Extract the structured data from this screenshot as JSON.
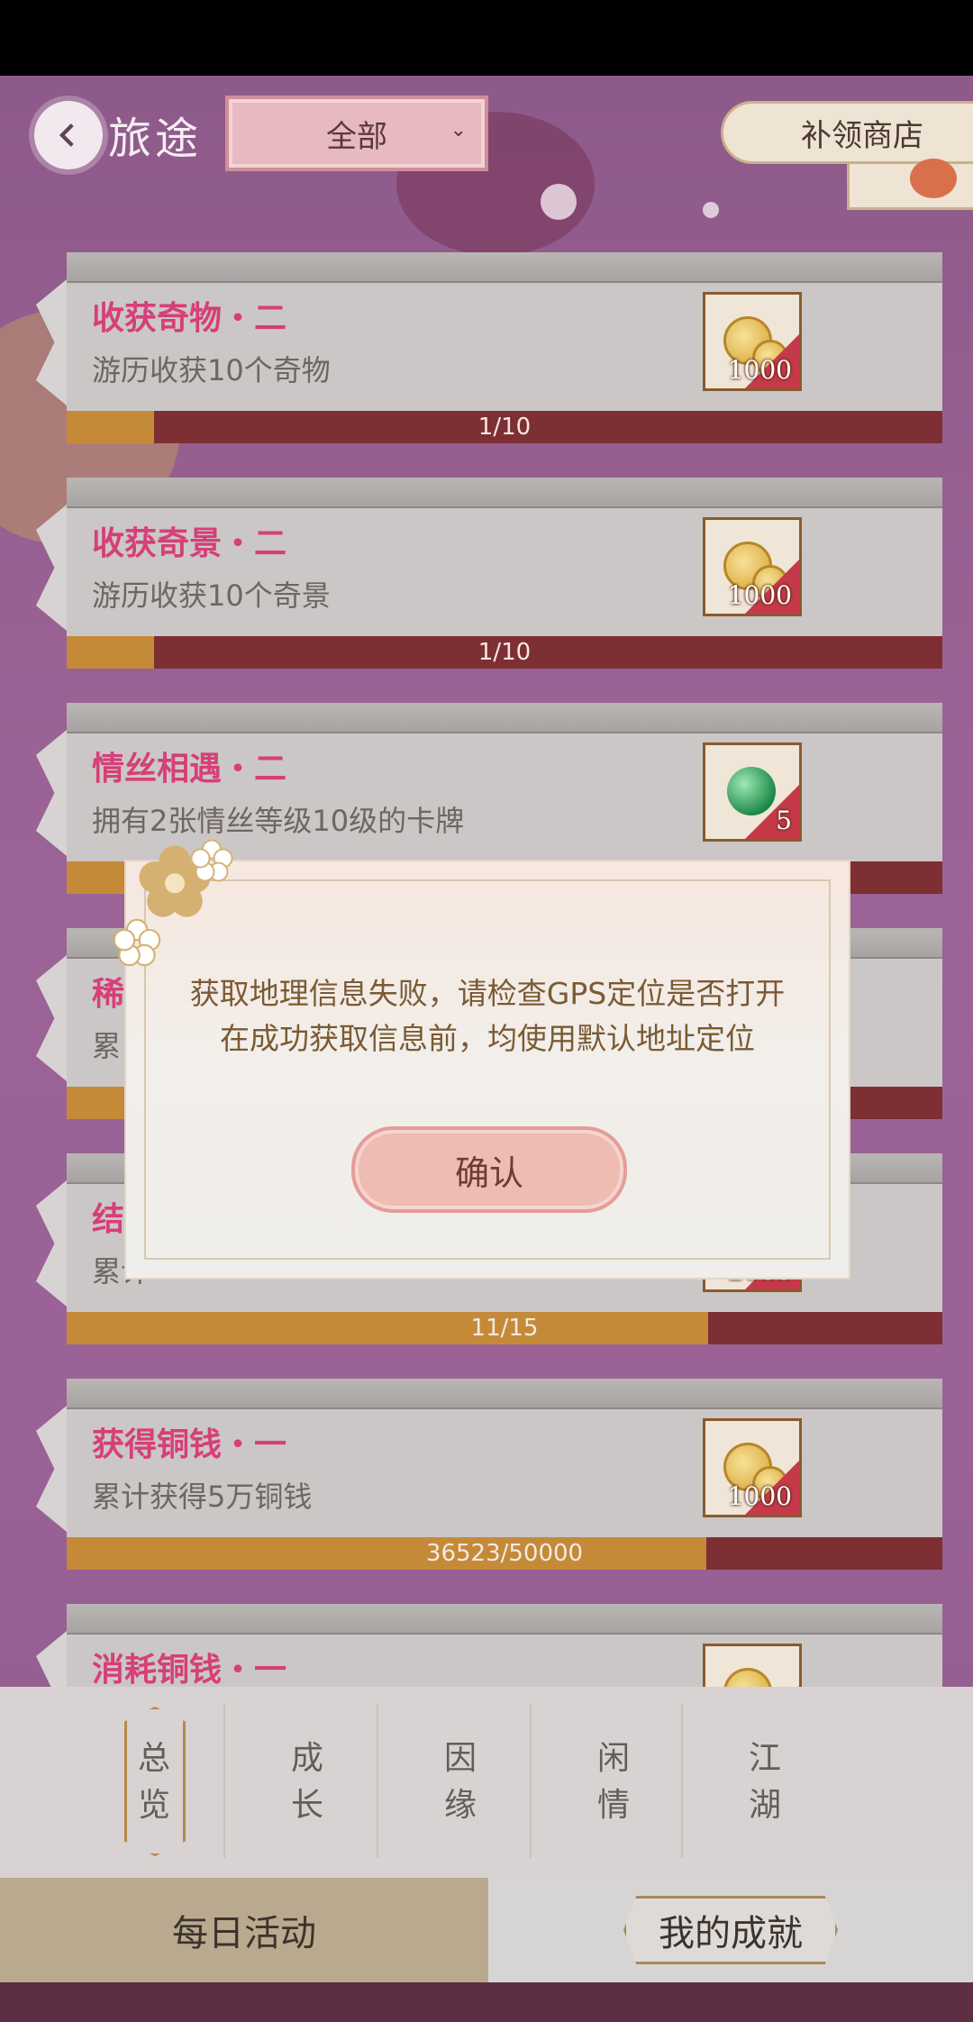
{
  "header": {
    "title": "旅途",
    "filter_value": "全部",
    "shop_label": "补领商店"
  },
  "achievements": [
    {
      "title": "收获奇物・二",
      "desc": "游历收获10个奇物",
      "reward_type": "coin",
      "reward_qty": "1000",
      "progress_text": "1/10",
      "progress": 0.1
    },
    {
      "title": "收获奇景・二",
      "desc": "游历收获10个奇景",
      "reward_type": "coin",
      "reward_qty": "1000",
      "progress_text": "1/10",
      "progress": 0.1
    },
    {
      "title": "情丝相遇・二",
      "desc": "拥有2张情丝等级10级的卡牌",
      "reward_type": "jade",
      "reward_qty": "5",
      "progress_text": "",
      "progress": 0.1
    },
    {
      "title": "稀",
      "desc": "累",
      "reward_type": "none",
      "reward_qty": "",
      "progress_text": "",
      "progress": 0.1
    },
    {
      "title": "结",
      "desc": "累计",
      "reward_type": "coin",
      "reward_qty": "2000",
      "progress_text": "11/15",
      "progress": 0.733
    },
    {
      "title": "获得铜钱・一",
      "desc": "累计获得5万铜钱",
      "reward_type": "coin",
      "reward_qty": "1000",
      "progress_text": "36523/50000",
      "progress": 0.73
    },
    {
      "title": "消耗铜钱・一",
      "desc": "",
      "reward_type": "coin",
      "reward_qty": "",
      "progress_text": "",
      "progress": 0
    }
  ],
  "dialog": {
    "line1": "获取地理信息失败，请检查GPS定位是否打开",
    "line2": "在成功获取信息前，均使用默认地址定位",
    "confirm_label": "确认"
  },
  "tabs": [
    {
      "top": "总",
      "bottom": "览",
      "active": true
    },
    {
      "top": "成",
      "bottom": "长",
      "active": false
    },
    {
      "top": "因",
      "bottom": "缘",
      "active": false
    },
    {
      "top": "闲",
      "bottom": "情",
      "active": false
    },
    {
      "top": "江",
      "bottom": "湖",
      "active": false
    }
  ],
  "bottom": {
    "daily_label": "每日活动",
    "achieve_label": "我的成就"
  },
  "colors": {
    "title_pink": "#d63f78",
    "progress_fill": "#c58a38",
    "progress_track": "#7e2f33",
    "dialog_text": "#7a5a34"
  }
}
